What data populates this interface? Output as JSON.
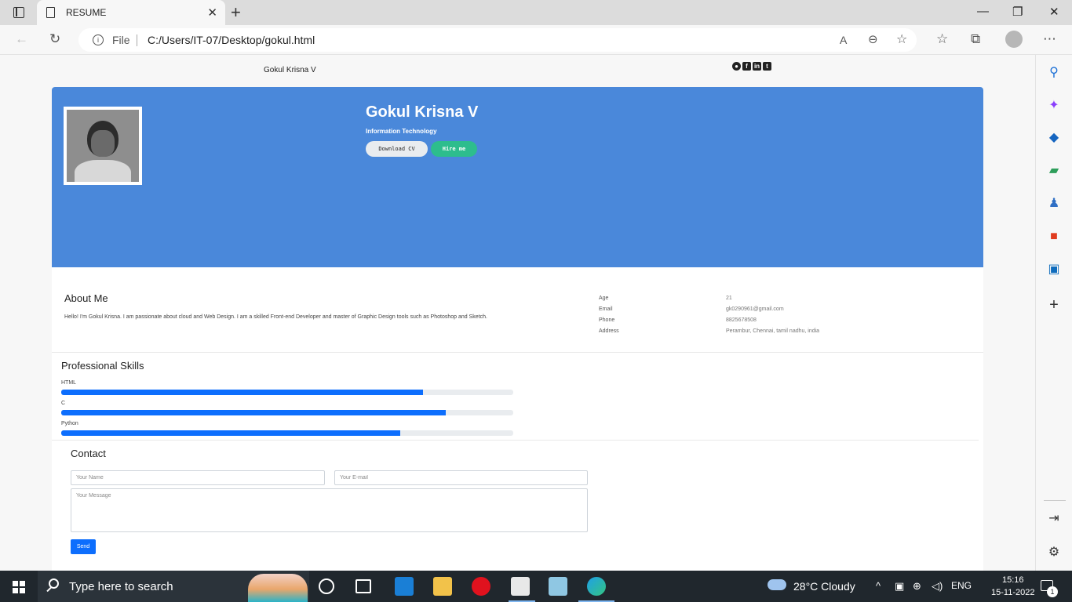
{
  "browser": {
    "tab_title": "RESUME",
    "address": {
      "scheme_label": "File",
      "url": "C:/Users/IT-07/Desktop/gokul.html"
    }
  },
  "page": {
    "site_name": "Gokul Krisna V",
    "socials": [
      "github-icon",
      "facebook-icon",
      "linkedin-icon",
      "twitter-icon"
    ],
    "hero": {
      "name": "Gokul Krisna V",
      "role": "Information Technology",
      "download_cv_label": "Download CV",
      "hire_me_label": "Hire me",
      "background_color": "#4a88da"
    },
    "about": {
      "title": "About Me",
      "text": "Hello! I'm Gokul Krisna. I am passionate about cloud and Web Design. I am a skilled Front-end Developer and master of Graphic Design tools such as Photoshop and Sketch."
    },
    "info": [
      {
        "key": "Age",
        "value": "21"
      },
      {
        "key": "Email",
        "value": "gk0290961@gmail.com"
      },
      {
        "key": "Phone",
        "value": "8825678508"
      },
      {
        "key": "Address",
        "value": "Perambur, Chennai, tamil nadhu, india"
      }
    ],
    "skills": {
      "title": "Professional Skills",
      "items": [
        {
          "name": "HTML",
          "percent": 80
        },
        {
          "name": "C",
          "percent": 85
        },
        {
          "name": "Python",
          "percent": 75
        }
      ]
    },
    "contact": {
      "title": "Contact",
      "name_placeholder": "Your Name",
      "email_placeholder": "Your E-mail",
      "message_placeholder": "Your Message",
      "send_label": "Send"
    }
  },
  "taskbar": {
    "search_placeholder": "Type here to search",
    "weather": "28°C  Cloudy",
    "language": "ENG",
    "time": "15:16",
    "date": "15-11-2022",
    "notification_count": "1"
  }
}
